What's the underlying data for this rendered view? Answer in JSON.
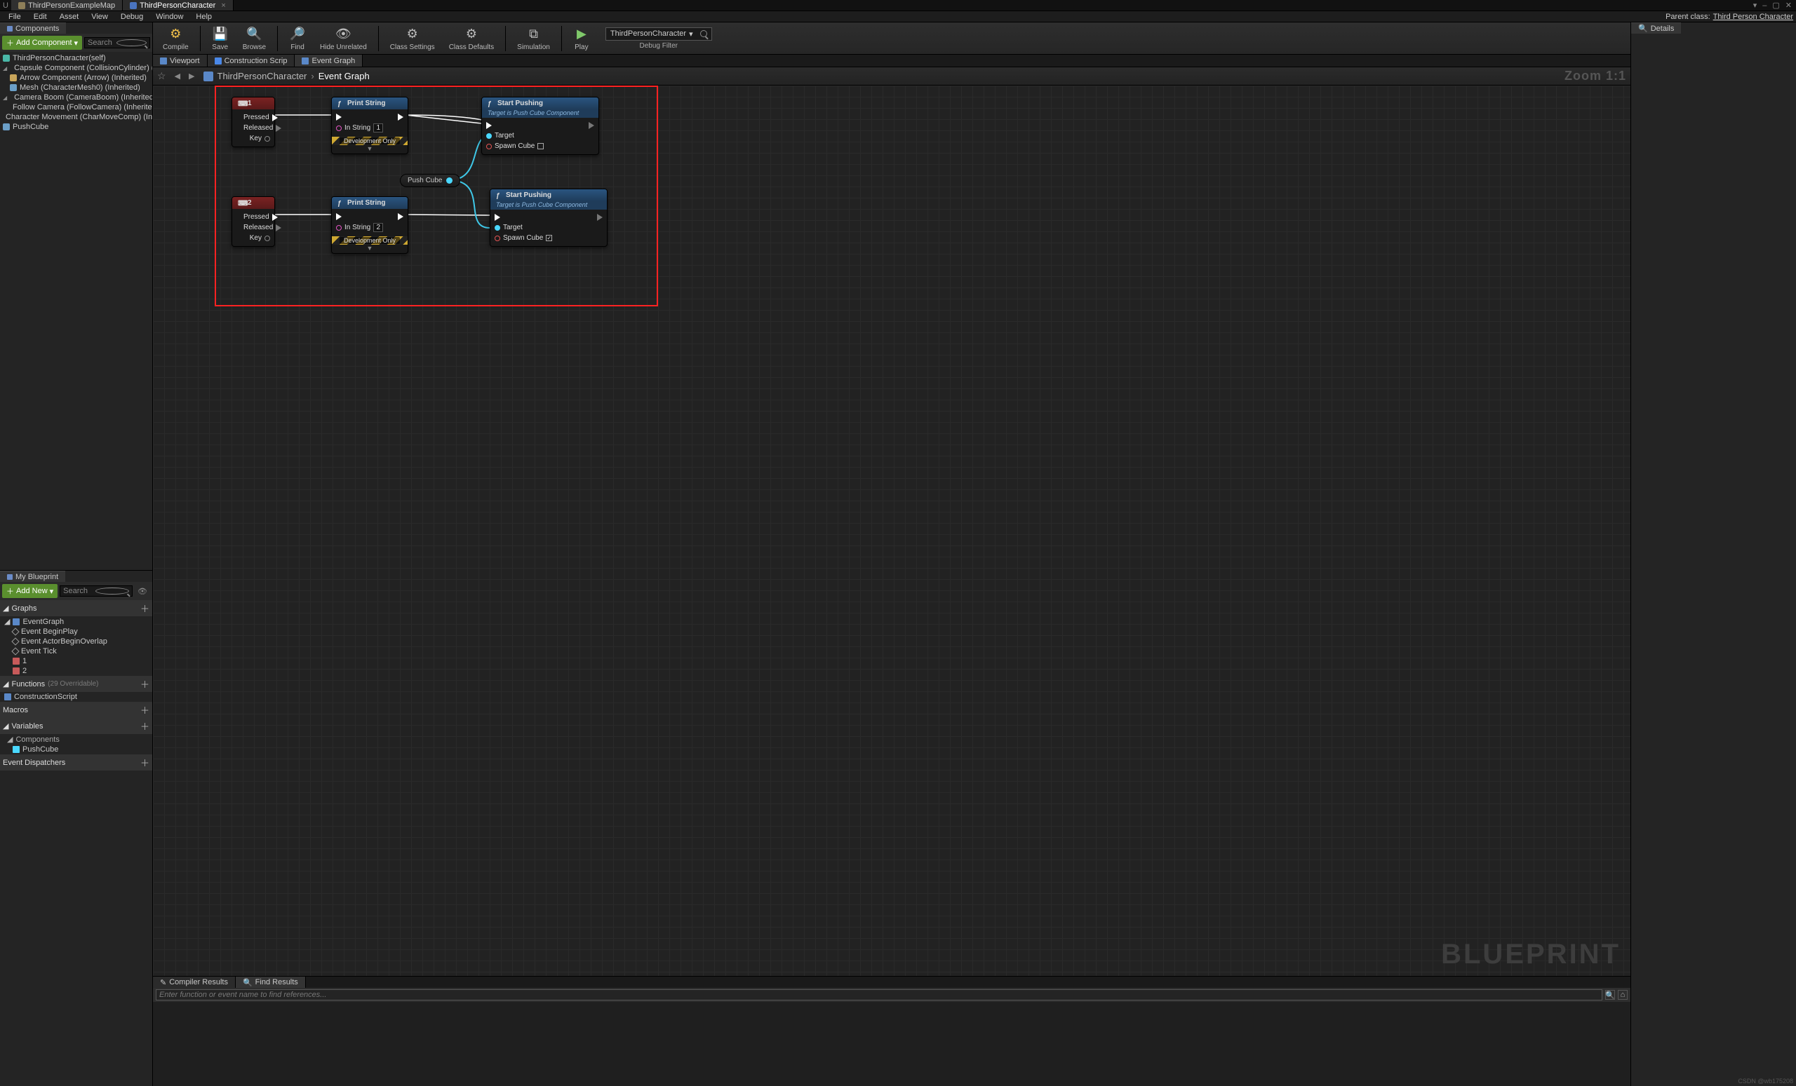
{
  "title_tabs": {
    "map": "ThirdPersonExampleMap",
    "character": "ThirdPersonCharacter"
  },
  "win_controls": {
    "down": "▾",
    "min": "–",
    "max": "▢",
    "close": "✕"
  },
  "menus": [
    "File",
    "Edit",
    "Asset",
    "View",
    "Debug",
    "Window",
    "Help"
  ],
  "parent_class": {
    "label": "Parent class:",
    "value": "Third Person Character"
  },
  "components_panel": {
    "title": "Components",
    "add_btn": "Add Component",
    "search_ph": "Search",
    "rows": [
      {
        "text": "ThirdPersonCharacter(self)",
        "lvl": 0,
        "ic": "cyan"
      },
      {
        "text": "Capsule Component (CollisionCylinder) (Inherited)",
        "lvl": 0,
        "ic": "blue",
        "exp": true
      },
      {
        "text": "Arrow Component (Arrow) (Inherited)",
        "lvl": 1,
        "ic": "orange"
      },
      {
        "text": "Mesh (CharacterMesh0) (Inherited)",
        "lvl": 1,
        "ic": "blue"
      },
      {
        "text": "Camera Boom (CameraBoom) (Inherited)",
        "lvl": 0,
        "ic": "blue",
        "exp": true
      },
      {
        "text": "Follow Camera (FollowCamera) (Inherited)",
        "lvl": 1,
        "ic": "cyan"
      },
      {
        "text": "Character Movement (CharMoveComp) (Inherited)",
        "lvl": 0,
        "ic": "cyan"
      },
      {
        "text": "PushCube",
        "lvl": 0,
        "ic": "blue"
      }
    ]
  },
  "my_bp": {
    "title": "My Blueprint",
    "add_new": "Add New",
    "search_ph": "Search",
    "sections": {
      "graphs": {
        "title": "Graphs",
        "items": [
          "EventGraph",
          "Event BeginPlay",
          "Event ActorBeginOverlap",
          "Event Tick",
          "1",
          "2"
        ]
      },
      "functions": {
        "title": "Functions",
        "sub": "(29 Overridable)",
        "items": [
          "ConstructionScript"
        ]
      },
      "macros": {
        "title": "Macros"
      },
      "variables": {
        "title": "Variables",
        "componentsLabel": "Components",
        "items": [
          "PushCube"
        ]
      },
      "dispatchers": {
        "title": "Event Dispatchers"
      }
    }
  },
  "toolbar": {
    "compile": "Compile",
    "save": "Save",
    "browse": "Browse",
    "find": "Find",
    "hide": "Hide Unrelated",
    "class_settings": "Class Settings",
    "class_defaults": "Class Defaults",
    "simulation": "Simulation",
    "play": "Play",
    "filter_value": "ThirdPersonCharacter",
    "filter_label": "Debug Filter"
  },
  "editor_tabs": {
    "viewport": "Viewport",
    "cs": "Construction Scrip",
    "eg": "Event Graph"
  },
  "graph_bar": {
    "root": "ThirdPersonCharacter",
    "leaf": "Event Graph",
    "sep": "›",
    "zoom": "Zoom 1:1"
  },
  "watermark": "BLUEPRINT",
  "nodes": {
    "key1": {
      "title": "1",
      "pressed": "Pressed",
      "released": "Released",
      "key": "Key"
    },
    "key2": {
      "title": "2",
      "pressed": "Pressed",
      "released": "Released",
      "key": "Key"
    },
    "print1": {
      "title": "Print String",
      "in_string": "In String",
      "val": "1",
      "dev": "Development Only"
    },
    "print2": {
      "title": "Print String",
      "in_string": "In String",
      "val": "2",
      "dev": "Development Only"
    },
    "start1": {
      "title": "Start Pushing",
      "sub": "Target is Push Cube Component",
      "target": "Target",
      "spawn": "Spawn Cube"
    },
    "start2": {
      "title": "Start Pushing",
      "sub": "Target is Push Cube Component",
      "target": "Target",
      "spawn": "Spawn Cube"
    },
    "pushcube": {
      "label": "Push Cube"
    }
  },
  "results": {
    "compiler": "Compiler Results",
    "find": "Find Results",
    "placeholder": "Enter function or event name to find references..."
  },
  "details": {
    "title": "Details"
  },
  "credit": "CSDN @wb175208"
}
